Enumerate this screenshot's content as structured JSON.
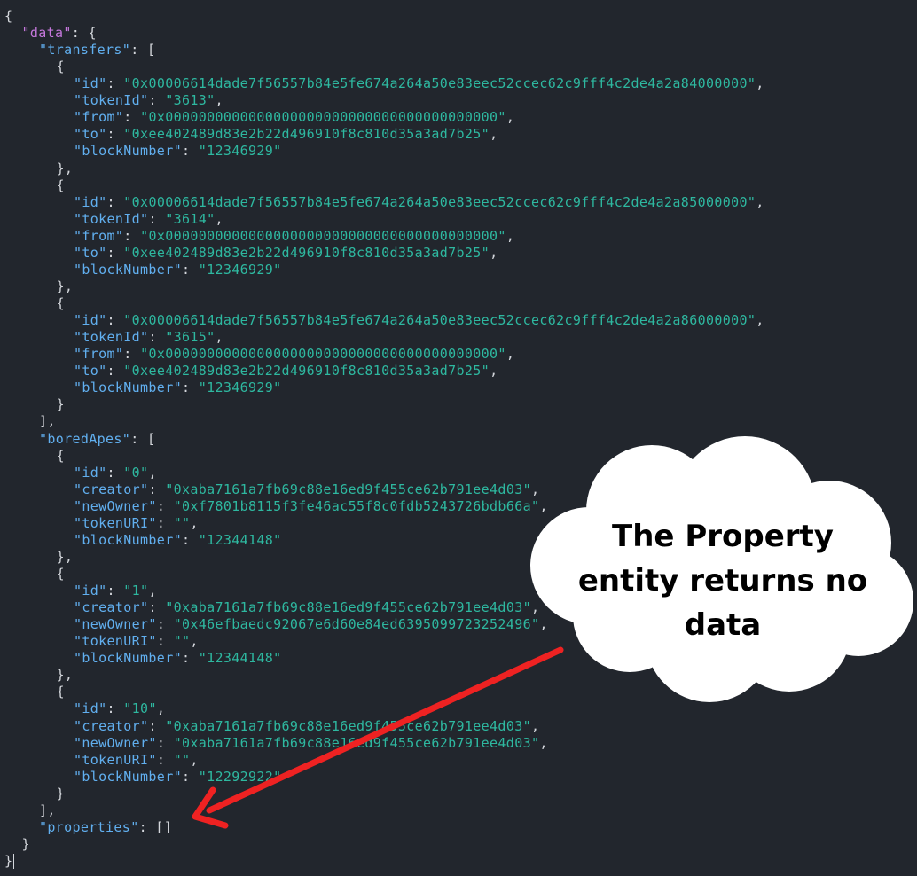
{
  "code_lines": [
    {
      "i": 0,
      "k": "",
      "v": "",
      "s": "{",
      "root": false,
      "caret": false
    },
    {
      "i": 1,
      "k": "data",
      "v": "",
      "s": ": {",
      "root": true,
      "caret": false
    },
    {
      "i": 2,
      "k": "transfers",
      "v": "",
      "s": ": [",
      "root": false,
      "caret": false
    },
    {
      "i": 3,
      "k": "",
      "v": "",
      "s": "{",
      "root": false,
      "caret": false
    },
    {
      "i": 4,
      "k": "id",
      "v": "\"0x00006614dade7f56557b84e5fe674a264a50e83eec52ccec62c9fff4c2de4a2a84000000\"",
      "s": ",",
      "root": false,
      "caret": false
    },
    {
      "i": 4,
      "k": "tokenId",
      "v": "\"3613\"",
      "s": ",",
      "root": false,
      "caret": false
    },
    {
      "i": 4,
      "k": "from",
      "v": "\"0x0000000000000000000000000000000000000000\"",
      "s": ",",
      "root": false,
      "caret": false
    },
    {
      "i": 4,
      "k": "to",
      "v": "\"0xee402489d83e2b22d496910f8c810d35a3ad7b25\"",
      "s": ",",
      "root": false,
      "caret": false
    },
    {
      "i": 4,
      "k": "blockNumber",
      "v": "\"12346929\"",
      "s": "",
      "root": false,
      "caret": false
    },
    {
      "i": 3,
      "k": "",
      "v": "",
      "s": "},",
      "root": false,
      "caret": false
    },
    {
      "i": 3,
      "k": "",
      "v": "",
      "s": "{",
      "root": false,
      "caret": false
    },
    {
      "i": 4,
      "k": "id",
      "v": "\"0x00006614dade7f56557b84e5fe674a264a50e83eec52ccec62c9fff4c2de4a2a85000000\"",
      "s": ",",
      "root": false,
      "caret": false
    },
    {
      "i": 4,
      "k": "tokenId",
      "v": "\"3614\"",
      "s": ",",
      "root": false,
      "caret": false
    },
    {
      "i": 4,
      "k": "from",
      "v": "\"0x0000000000000000000000000000000000000000\"",
      "s": ",",
      "root": false,
      "caret": false
    },
    {
      "i": 4,
      "k": "to",
      "v": "\"0xee402489d83e2b22d496910f8c810d35a3ad7b25\"",
      "s": ",",
      "root": false,
      "caret": false
    },
    {
      "i": 4,
      "k": "blockNumber",
      "v": "\"12346929\"",
      "s": "",
      "root": false,
      "caret": false
    },
    {
      "i": 3,
      "k": "",
      "v": "",
      "s": "},",
      "root": false,
      "caret": false
    },
    {
      "i": 3,
      "k": "",
      "v": "",
      "s": "{",
      "root": false,
      "caret": false
    },
    {
      "i": 4,
      "k": "id",
      "v": "\"0x00006614dade7f56557b84e5fe674a264a50e83eec52ccec62c9fff4c2de4a2a86000000\"",
      "s": ",",
      "root": false,
      "caret": false
    },
    {
      "i": 4,
      "k": "tokenId",
      "v": "\"3615\"",
      "s": ",",
      "root": false,
      "caret": false
    },
    {
      "i": 4,
      "k": "from",
      "v": "\"0x0000000000000000000000000000000000000000\"",
      "s": ",",
      "root": false,
      "caret": false
    },
    {
      "i": 4,
      "k": "to",
      "v": "\"0xee402489d83e2b22d496910f8c810d35a3ad7b25\"",
      "s": ",",
      "root": false,
      "caret": false
    },
    {
      "i": 4,
      "k": "blockNumber",
      "v": "\"12346929\"",
      "s": "",
      "root": false,
      "caret": false
    },
    {
      "i": 3,
      "k": "",
      "v": "",
      "s": "}",
      "root": false,
      "caret": false
    },
    {
      "i": 2,
      "k": "",
      "v": "",
      "s": "],",
      "root": false,
      "caret": false
    },
    {
      "i": 2,
      "k": "boredApes",
      "v": "",
      "s": ": [",
      "root": false,
      "caret": false
    },
    {
      "i": 3,
      "k": "",
      "v": "",
      "s": "{",
      "root": false,
      "caret": false
    },
    {
      "i": 4,
      "k": "id",
      "v": "\"0\"",
      "s": ",",
      "root": false,
      "caret": false
    },
    {
      "i": 4,
      "k": "creator",
      "v": "\"0xaba7161a7fb69c88e16ed9f455ce62b791ee4d03\"",
      "s": ",",
      "root": false,
      "caret": false
    },
    {
      "i": 4,
      "k": "newOwner",
      "v": "\"0xf7801b8115f3fe46ac55f8c0fdb5243726bdb66a\"",
      "s": ",",
      "root": false,
      "caret": false
    },
    {
      "i": 4,
      "k": "tokenURI",
      "v": "\"\"",
      "s": ",",
      "root": false,
      "caret": false
    },
    {
      "i": 4,
      "k": "blockNumber",
      "v": "\"12344148\"",
      "s": "",
      "root": false,
      "caret": false
    },
    {
      "i": 3,
      "k": "",
      "v": "",
      "s": "},",
      "root": false,
      "caret": false
    },
    {
      "i": 3,
      "k": "",
      "v": "",
      "s": "{",
      "root": false,
      "caret": false
    },
    {
      "i": 4,
      "k": "id",
      "v": "\"1\"",
      "s": ",",
      "root": false,
      "caret": false
    },
    {
      "i": 4,
      "k": "creator",
      "v": "\"0xaba7161a7fb69c88e16ed9f455ce62b791ee4d03\"",
      "s": ",",
      "root": false,
      "caret": false
    },
    {
      "i": 4,
      "k": "newOwner",
      "v": "\"0x46efbaedc92067e6d60e84ed6395099723252496\"",
      "s": ",",
      "root": false,
      "caret": false
    },
    {
      "i": 4,
      "k": "tokenURI",
      "v": "\"\"",
      "s": ",",
      "root": false,
      "caret": false
    },
    {
      "i": 4,
      "k": "blockNumber",
      "v": "\"12344148\"",
      "s": "",
      "root": false,
      "caret": false
    },
    {
      "i": 3,
      "k": "",
      "v": "",
      "s": "},",
      "root": false,
      "caret": false
    },
    {
      "i": 3,
      "k": "",
      "v": "",
      "s": "{",
      "root": false,
      "caret": false
    },
    {
      "i": 4,
      "k": "id",
      "v": "\"10\"",
      "s": ",",
      "root": false,
      "caret": false
    },
    {
      "i": 4,
      "k": "creator",
      "v": "\"0xaba7161a7fb69c88e16ed9f455ce62b791ee4d03\"",
      "s": ",",
      "root": false,
      "caret": false
    },
    {
      "i": 4,
      "k": "newOwner",
      "v": "\"0xaba7161a7fb69c88e16ed9f455ce62b791ee4d03\"",
      "s": ",",
      "root": false,
      "caret": false
    },
    {
      "i": 4,
      "k": "tokenURI",
      "v": "\"\"",
      "s": ",",
      "root": false,
      "caret": false
    },
    {
      "i": 4,
      "k": "blockNumber",
      "v": "\"12292922\"",
      "s": "",
      "root": false,
      "caret": false
    },
    {
      "i": 3,
      "k": "",
      "v": "",
      "s": "}",
      "root": false,
      "caret": false
    },
    {
      "i": 2,
      "k": "",
      "v": "",
      "s": "],",
      "root": false,
      "caret": false
    },
    {
      "i": 2,
      "k": "properties",
      "v": "",
      "s": ": []",
      "root": false,
      "caret": false
    },
    {
      "i": 1,
      "k": "",
      "v": "",
      "s": "}",
      "root": false,
      "caret": false
    },
    {
      "i": 0,
      "k": "",
      "v": "",
      "s": "}",
      "root": false,
      "caret": true
    }
  ],
  "callout": {
    "text": "The Property entity returns no data"
  },
  "colors": {
    "background": "#22262d",
    "root_key": "#c678dd",
    "key": "#61afef",
    "string": "#2eb8a0",
    "punctuation": "#d4d7dc",
    "arrow": "#ee2222",
    "cloud_fill": "#ffffff",
    "cloud_text": "#000000"
  }
}
